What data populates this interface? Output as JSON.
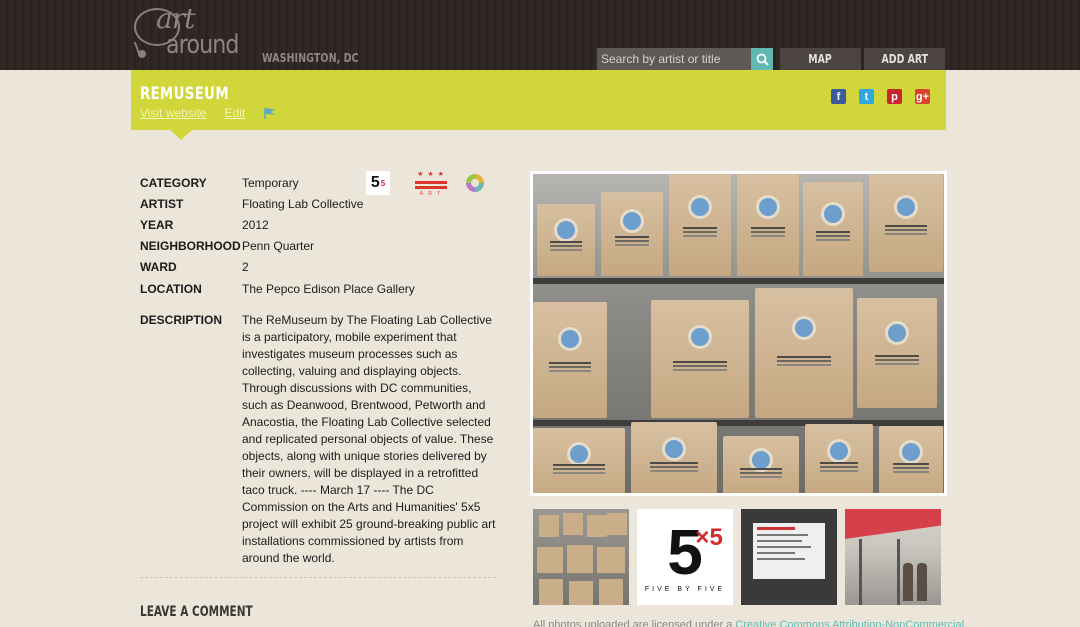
{
  "header": {
    "logo_top": "art",
    "logo_bottom": "around",
    "city": "WASHINGTON, DC",
    "search_placeholder": "Search by artist or title",
    "nav": {
      "map": "MAP",
      "add_art": "ADD ART"
    }
  },
  "banner": {
    "title": "REMUSEUM",
    "visit_website": "Visit website",
    "edit": "Edit",
    "social": [
      "f",
      "t",
      "p",
      "g+"
    ]
  },
  "details": {
    "category_label": "CATEGORY",
    "category": "Temporary",
    "artist_label": "ARTIST",
    "artist": "Floating Lab Collective",
    "year_label": "YEAR",
    "year": "2012",
    "neighborhood_label": "NEIGHBORHOOD",
    "neighborhood": "Penn Quarter",
    "ward_label": "WARD",
    "ward": "2",
    "location_label": "LOCATION",
    "location": "The Pepco Edison Place Gallery",
    "description_label": "DESCRIPTION",
    "description": "The ReMuseum by The Floating Lab Collective is a participatory, mobile experiment that investigates museum processes such as collecting, valuing and displaying objects. Through discussions with DC communities, such as Deanwood, Brentwood, Petworth and Anacostia, the Floating Lab Collective selected and replicated personal objects of value. These objects, along with unique stories delivered by their owners, will be displayed in a retrofitted taco truck. ---- March 17 ---- The DC Commission on the Arts and Humanities' 5x5 project will exhibit 25 ground-breaking public art installations commissioned by artists from around the world."
  },
  "badges": {
    "five_big": "5",
    "five_small": "5",
    "dc_stars": "★ ★ ★",
    "dc_text": "A R T"
  },
  "photos": {
    "thumb2_big": "5",
    "thumb2_sup": "×5",
    "thumb2_caption": "FIVE BY FIVE"
  },
  "comments": {
    "heading": "LEAVE A COMMENT"
  },
  "footnote": {
    "prefix": "All photos uploaded are licensed under a ",
    "link": "Creative Commons Attribution-NonCommercial"
  },
  "colors": {
    "banner": "#d1d63a",
    "accent": "#5fb9b1",
    "header": "#2f2723"
  }
}
